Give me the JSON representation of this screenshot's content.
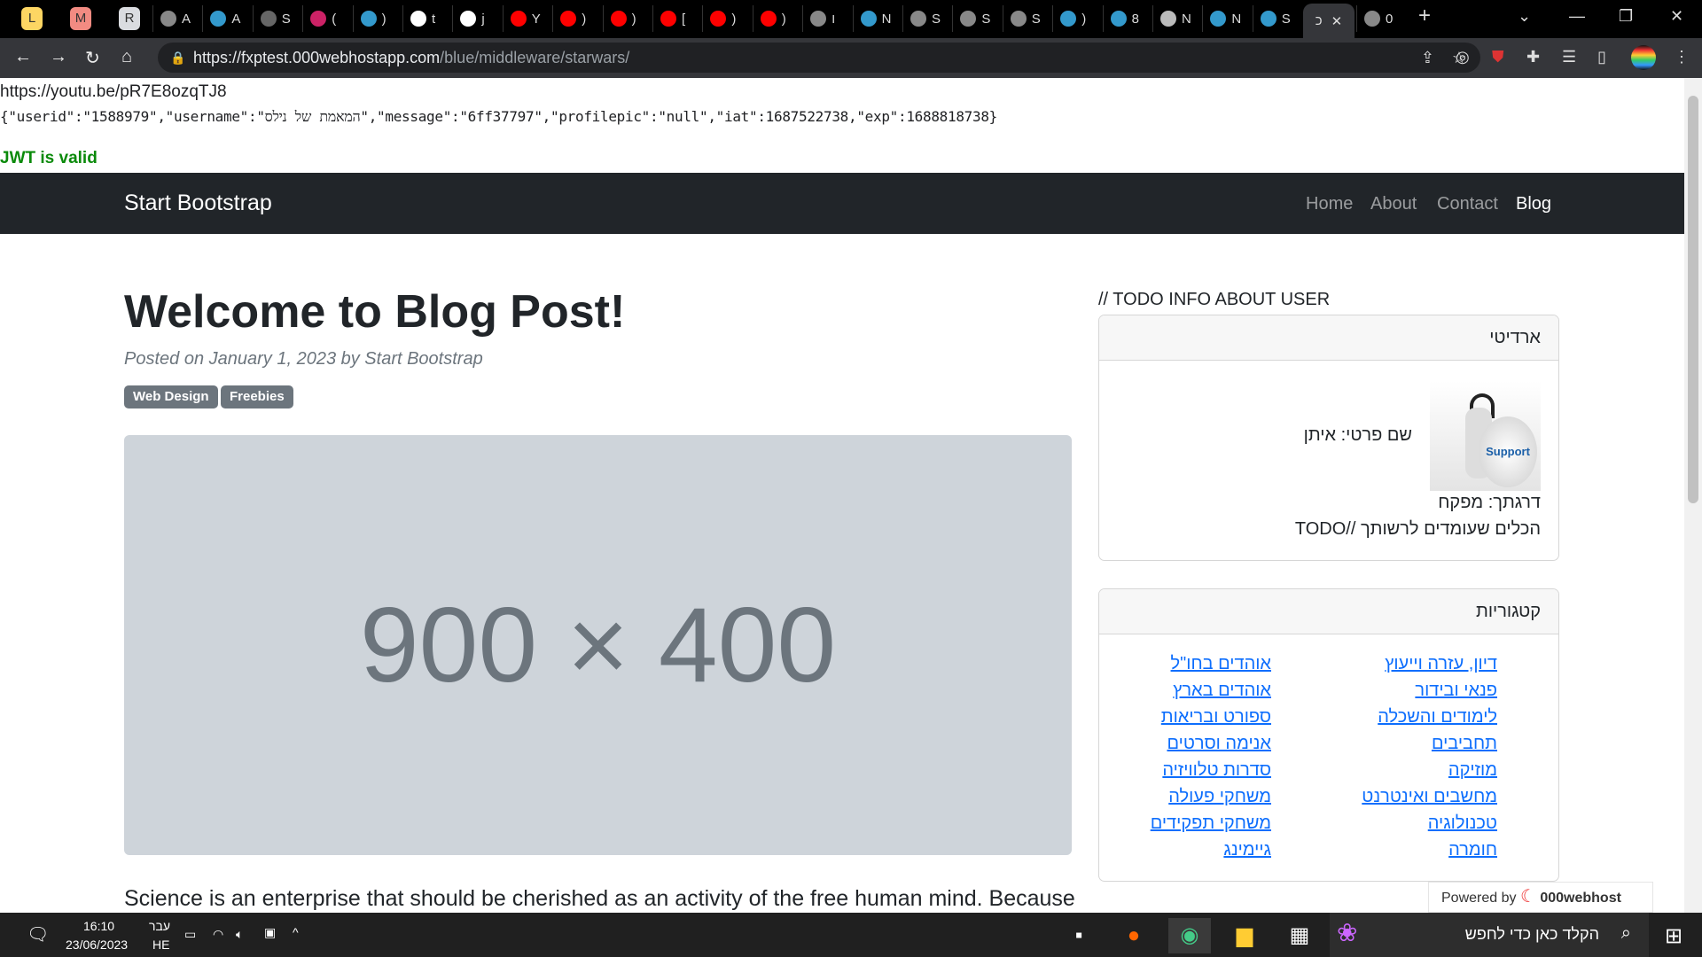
{
  "browser": {
    "pinned_tabs": [
      {
        "label": "L",
        "color": "#fdd663"
      },
      {
        "label": "M",
        "color": "#f28b82"
      },
      {
        "label": "R",
        "color": "#dadce0"
      }
    ],
    "tabs": [
      {
        "label": "A",
        "icon": "globe-icon"
      },
      {
        "label": "A",
        "icon": "app-icon"
      },
      {
        "label": "S",
        "icon": "touch-icon"
      },
      {
        "label": "(",
        "icon": "gem-icon"
      },
      {
        "label": ")",
        "icon": "app-icon"
      },
      {
        "label": "t",
        "icon": "google-icon"
      },
      {
        "label": "j",
        "icon": "google-icon"
      },
      {
        "label": "Y",
        "icon": "youtube-icon"
      },
      {
        "label": ")",
        "icon": "youtube-icon"
      },
      {
        "label": ")",
        "icon": "youtube-icon"
      },
      {
        "label": "[",
        "icon": "youtube-icon"
      },
      {
        "label": ")",
        "icon": "youtube-icon"
      },
      {
        "label": ")",
        "icon": "youtube-icon"
      },
      {
        "label": "ו",
        "icon": "globe-icon"
      },
      {
        "label": "N",
        "icon": "app-icon"
      },
      {
        "label": "S",
        "icon": "globe-icon"
      },
      {
        "label": "S",
        "icon": "globe-icon"
      },
      {
        "label": "S",
        "icon": "globe-icon"
      },
      {
        "label": ")",
        "icon": "app-icon"
      },
      {
        "label": "8",
        "icon": "app-icon"
      },
      {
        "label": "N",
        "icon": "gear-icon"
      },
      {
        "label": "N",
        "icon": "app-icon"
      },
      {
        "label": "S",
        "icon": "app-icon"
      }
    ],
    "active_tab": "כ",
    "after_tab": "0",
    "url_host": "https://fxptest.000webhostapp.com",
    "url_path": "/blue/middleware/starwars/"
  },
  "page": {
    "link": "https://youtu.be/pR7E8ozqTJ8",
    "json_line": "{\"userid\":\"1588979\",\"username\":\"המאמת של נילס\",\"message\":\"6ff37797\",\"profilepic\":\"null\",\"iat\":1687522738,\"exp\":1688818738}",
    "jwt_status": "JWT is valid",
    "jwt_color": "#0a8a0a"
  },
  "navbar": {
    "brand": "Start Bootstrap",
    "links": [
      "Home",
      "About",
      "Contact",
      "Blog"
    ],
    "active": "Blog"
  },
  "post": {
    "title": "Welcome to Blog Post!",
    "meta": "Posted on January 1, 2023 by Start Bootstrap",
    "badges": [
      "Web Design",
      "Freebies"
    ],
    "image_text": "900 × 400",
    "body": "Science is an enterprise that should be cherished as an activity of the free human mind. Because"
  },
  "sidebar": {
    "todo": "// TODO INFO ABOUT USER",
    "user_card": {
      "header": "ארדיטי",
      "first_name": "שם פרטי: איתן",
      "avatar_text": "Support",
      "rank": "דרגתך: מפקח",
      "tools": "הכלים שעומדים לרשותך //TODO"
    },
    "categories": {
      "header": "קטגוריות",
      "right": [
        "דיון, עזרה וייעוץ",
        "פנאי ובידור",
        "לימודים והשכלה",
        "תחביבים",
        "מוזיקה",
        "מחשבים ואינטרנט",
        "טכנולוגיה",
        "חומרה"
      ],
      "left": [
        "אוהדים בחו\"ל",
        "אוהדים בארץ",
        "ספורט ובריאות",
        "אנימה וסרטים",
        "סדרות טלוויזיה",
        "משחקי פעולה",
        "משחקי תפקידים",
        "גיימינג"
      ]
    }
  },
  "powered": {
    "label": "Powered by",
    "brand": "000webhost"
  },
  "taskbar": {
    "time": "16:10",
    "date": "23/06/2023",
    "lang_top": "עבר",
    "lang_bottom": "HE",
    "search": "הקלד כאן כדי לחפש"
  }
}
